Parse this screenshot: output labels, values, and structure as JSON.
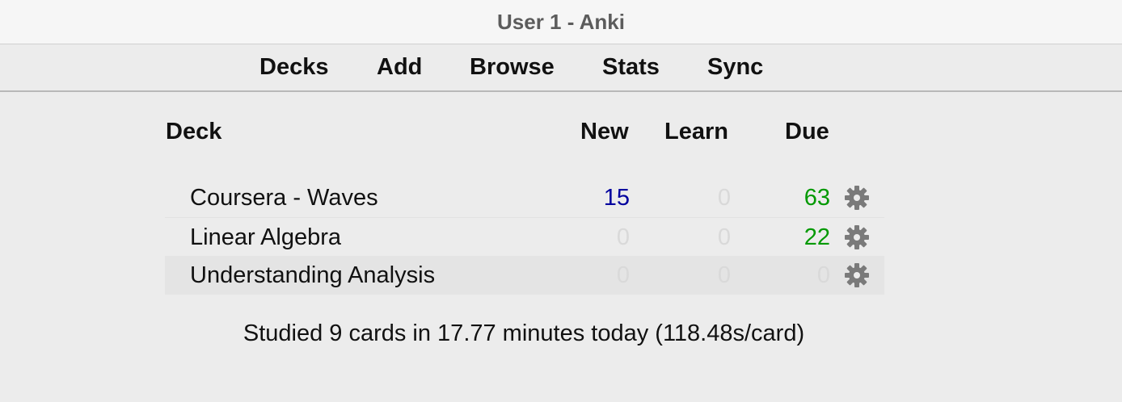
{
  "window": {
    "title": "User 1 - Anki"
  },
  "toolbar": {
    "items": [
      "Decks",
      "Add",
      "Browse",
      "Stats",
      "Sync"
    ]
  },
  "deck_table": {
    "columns": {
      "deck": "Deck",
      "new": "New",
      "learn": "Learn",
      "due": "Due"
    },
    "rows": [
      {
        "name": "Coursera - Waves",
        "new": "15",
        "learn": "0",
        "due": "63"
      },
      {
        "name": "Linear Algebra",
        "new": "0",
        "learn": "0",
        "due": "22"
      },
      {
        "name": "Understanding Analysis",
        "new": "0",
        "learn": "0",
        "due": "0"
      }
    ]
  },
  "footer": {
    "studied": "Studied 9 cards in 17.77 minutes today (118.48s/card)"
  },
  "colors": {
    "new": "#00009e",
    "due": "#009900",
    "zero": "#d9d9d9",
    "gear": "#7a7a7a"
  }
}
